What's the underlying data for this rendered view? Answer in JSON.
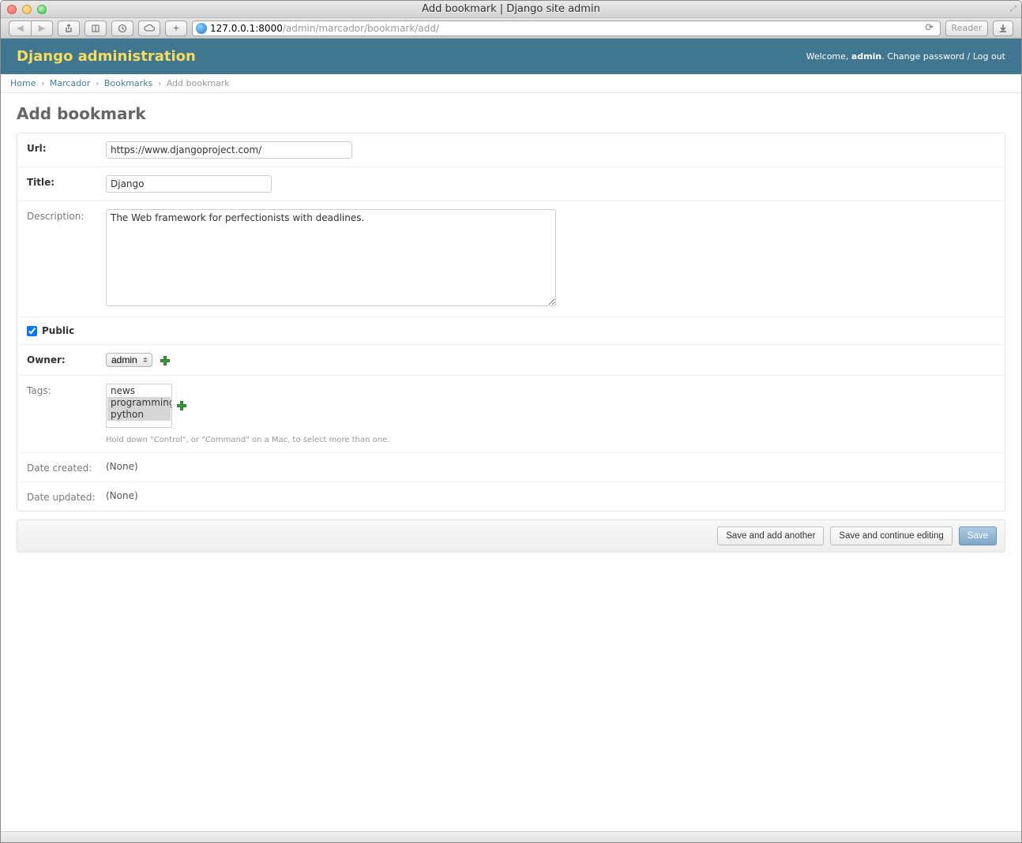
{
  "window": {
    "title": "Add bookmark | Django site admin"
  },
  "browser": {
    "url_host": "127.0.0.1:8000",
    "url_path": "/admin/marcador/bookmark/add/",
    "reader_label": "Reader"
  },
  "header": {
    "branding": "Django administration",
    "welcome_prefix": "Welcome, ",
    "username": "admin",
    "change_password": "Change password",
    "logout": "Log out"
  },
  "breadcrumbs": {
    "home": "Home",
    "app": "Marcador",
    "model": "Bookmarks",
    "current": "Add bookmark"
  },
  "page_title": "Add bookmark",
  "form": {
    "url": {
      "label": "Url:",
      "value": "https://www.djangoproject.com/"
    },
    "title": {
      "label": "Title:",
      "value": "Django"
    },
    "description": {
      "label": "Description:",
      "value": "The Web framework for perfectionists with deadlines."
    },
    "public": {
      "label": "Public",
      "checked": true
    },
    "owner": {
      "label": "Owner:",
      "selected": "admin"
    },
    "tags": {
      "label": "Tags:",
      "options": [
        "news",
        "programming",
        "python"
      ],
      "selected": [
        "programming",
        "python"
      ],
      "help": "Hold down \"Control\", or \"Command\" on a Mac, to select more than one."
    },
    "date_created": {
      "label": "Date created:",
      "value": "(None)"
    },
    "date_updated": {
      "label": "Date updated:",
      "value": "(None)"
    }
  },
  "submit": {
    "save_add_another": "Save and add another",
    "save_continue": "Save and continue editing",
    "save": "Save"
  }
}
